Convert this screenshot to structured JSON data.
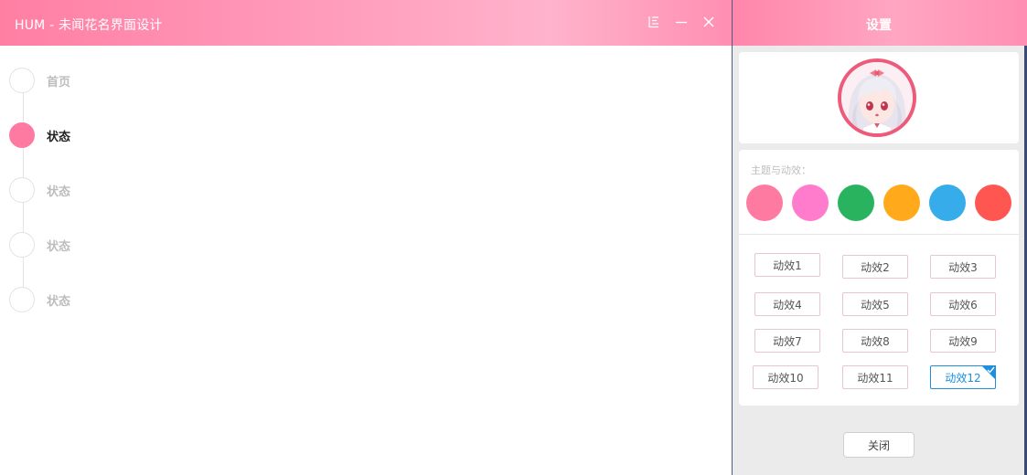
{
  "window": {
    "title": "HUM - 未闻花名界面设计"
  },
  "steps": [
    {
      "label": "首页",
      "active": false
    },
    {
      "label": "状态",
      "active": true
    },
    {
      "label": "状态",
      "active": false
    },
    {
      "label": "状态",
      "active": false
    },
    {
      "label": "状态",
      "active": false
    }
  ],
  "settings": {
    "title": "设置",
    "theme_label": "主题与动效：",
    "theme_colors": [
      "#ff7aa0",
      "#ff7ccc",
      "#29b35f",
      "#ffa91b",
      "#37acea",
      "#ff5652"
    ],
    "effects": [
      "动效1",
      "动效2",
      "动效3",
      "动效4",
      "动效5",
      "动效6",
      "动效7",
      "动效8",
      "动效9",
      "动效10",
      "动效11",
      "动效12"
    ],
    "selected_effect": "动效12",
    "close_label": "关闭"
  },
  "icons": {
    "menu": "menu-icon",
    "minimize": "minimize-icon",
    "close": "close-icon",
    "avatar": "anime-avatar",
    "check": "check-icon"
  }
}
